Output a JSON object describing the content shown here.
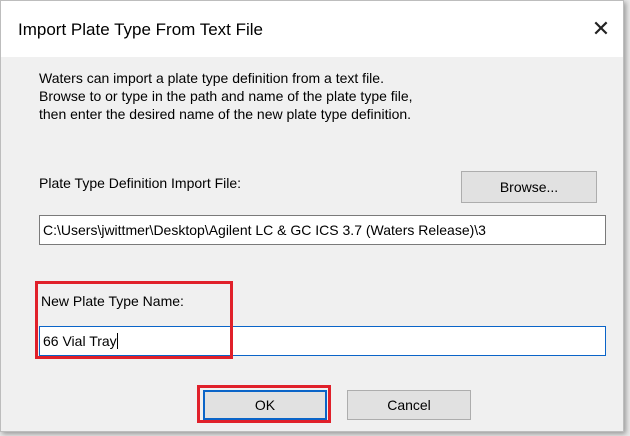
{
  "window": {
    "title": "Import Plate Type From Text File",
    "close_glyph": "✕"
  },
  "description": {
    "line1": "Waters can import a plate type definition from a text file.",
    "line2": "Browse to or type in the path and name of the plate type file,",
    "line3": "then enter the desired name of the new plate type definition."
  },
  "import_file": {
    "label": "Plate Type Definition Import File:",
    "browse_label": "Browse...",
    "path_value": "C:\\Users\\jwittmer\\Desktop\\Agilent LC & GC ICS 3.7 (Waters Release)\\3"
  },
  "new_name": {
    "label": "New Plate Type Name:",
    "value": "66 Vial Tray"
  },
  "buttons": {
    "ok_label": "OK",
    "cancel_label": "Cancel"
  },
  "colors": {
    "highlight": "#e0202a",
    "focus": "#0a64c8"
  }
}
